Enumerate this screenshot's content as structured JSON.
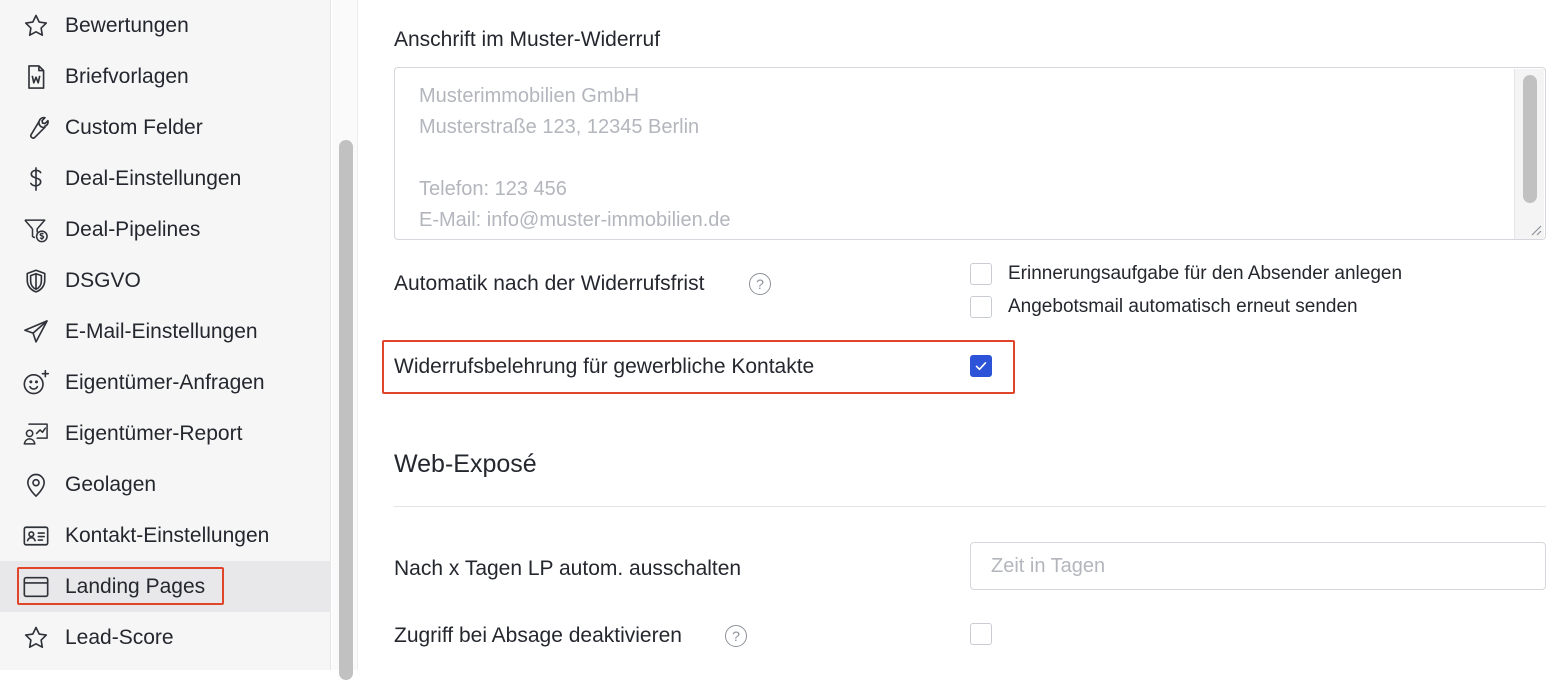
{
  "sidebar": {
    "items": [
      {
        "label": "Bewertungen",
        "icon": "star-icon"
      },
      {
        "label": "Briefvorlagen",
        "icon": "word-document-icon"
      },
      {
        "label": "Custom Felder",
        "icon": "wrench-icon"
      },
      {
        "label": "Deal-Einstellungen",
        "icon": "dollar-icon"
      },
      {
        "label": "Deal-Pipelines",
        "icon": "funnel-dollar-icon"
      },
      {
        "label": "DSGVO",
        "icon": "shield-icon"
      },
      {
        "label": "E-Mail-Einstellungen",
        "icon": "paper-plane-icon"
      },
      {
        "label": "Eigentümer-Anfragen",
        "icon": "smiley-plus-icon"
      },
      {
        "label": "Eigentümer-Report",
        "icon": "report-person-icon"
      },
      {
        "label": "Geolagen",
        "icon": "map-pin-icon"
      },
      {
        "label": "Kontakt-Einstellungen",
        "icon": "contact-card-icon"
      },
      {
        "label": "Landing Pages",
        "icon": "browser-window-icon",
        "active": true
      },
      {
        "label": "Lead-Score",
        "icon": "star-icon"
      }
    ]
  },
  "withdrawal": {
    "address_label": "Anschrift im Muster-Widerruf",
    "address_placeholder": "Musterimmobilien GmbH\nMusterstraße 123, 12345 Berlin\n\nTelefon: 123 456\nE-Mail: info@muster-immobilien.de",
    "automation_label": "Automatik nach der Widerrufsfrist",
    "automation_options": [
      {
        "label": "Erinnerungsaufgabe für den Absender anlegen",
        "checked": false
      },
      {
        "label": "Angebotsmail automatisch erneut senden",
        "checked": false
      }
    ],
    "commercial_label": "Widerrufsbelehrung für gewerbliche Kontakte",
    "commercial_checked": true
  },
  "web_expose": {
    "title": "Web-Exposé",
    "lp_disable_label": "Nach x Tagen LP autom. ausschalten",
    "lp_disable_placeholder": "Zeit in Tagen",
    "access_label": "Zugriff bei Absage deaktivieren",
    "access_checked": false
  },
  "colors": {
    "accent": "#2c53d8",
    "highlight": "#e0452c"
  }
}
